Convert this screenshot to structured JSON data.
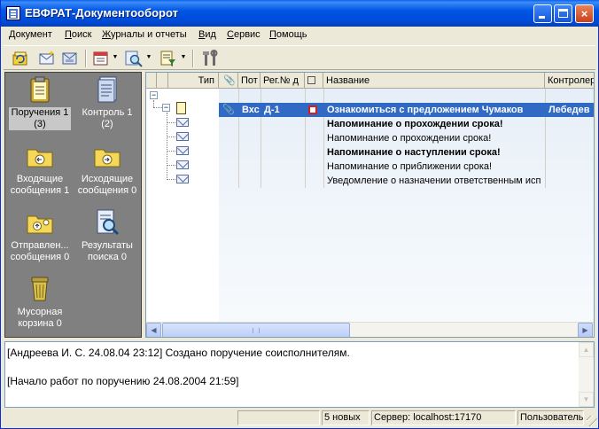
{
  "window": {
    "title": "ЕВФРАТ-Документооборот",
    "controls": {
      "minimize": "minimize",
      "maximize": "maximize",
      "close": "×"
    }
  },
  "menu": [
    {
      "label": "Документ",
      "u": "Д",
      "rest": "окумент"
    },
    {
      "label": "Поиск",
      "u": "П",
      "rest": "оиск"
    },
    {
      "label": "Журналы и отчеты",
      "u": "Ж",
      "rest": "урналы и отчеты"
    },
    {
      "label": "Вид",
      "u": "В",
      "rest": "ид"
    },
    {
      "label": "Сервис",
      "u": "С",
      "rest": "ервис"
    },
    {
      "label": "Помощь",
      "u": "П",
      "rest": "омощь"
    }
  ],
  "toolbar": {
    "icons": [
      "refresh-icon",
      "new-mail-icon",
      "mail-settings-icon",
      "calendar-icon",
      "search-icon",
      "filter-icon",
      "tools-icon"
    ]
  },
  "folders": [
    {
      "name": "poruchenia",
      "line1": "Поручения 1",
      "line2": "(3)",
      "selected": true
    },
    {
      "name": "control",
      "line1": "Контроль 1",
      "line2": "(2)",
      "selected": false
    },
    {
      "name": "incoming",
      "line1": "Входящие",
      "line2": "сообщения 1",
      "selected": false
    },
    {
      "name": "outgoing",
      "line1": "Исходящие",
      "line2": "сообщения 0",
      "selected": false
    },
    {
      "name": "sent",
      "line1": "Отправлен...",
      "line2": "сообщения 0",
      "selected": false
    },
    {
      "name": "search-results",
      "line1": "Результаты",
      "line2": "поиска 0",
      "selected": false
    },
    {
      "name": "trash",
      "line1": "Мусорная",
      "line2": "корзина 0",
      "selected": false
    }
  ],
  "grid": {
    "columns": {
      "type": "Тип",
      "attach": "",
      "sender": "Пот",
      "regnum": "Рег.№ д",
      "flag": "",
      "name": "Название",
      "controller": "Контролер"
    },
    "rows": [
      {
        "sender": "Вхс",
        "regnum": "Д-1",
        "name": "Ознакомиться с предложением Чумаков",
        "controller": "Лебедев",
        "selected": true,
        "bold": true
      },
      {
        "sender": "",
        "regnum": "",
        "name": "Напоминание о прохождении срока!",
        "controller": "",
        "selected": false,
        "bold": true
      },
      {
        "sender": "",
        "regnum": "",
        "name": "Напоминание о прохождении срока!",
        "controller": "",
        "selected": false,
        "bold": false
      },
      {
        "sender": "",
        "regnum": "",
        "name": "Напоминание о наступлении срока!",
        "controller": "",
        "selected": false,
        "bold": true
      },
      {
        "sender": "",
        "regnum": "",
        "name": "Напоминание о приближении срока!",
        "controller": "",
        "selected": false,
        "bold": false
      },
      {
        "sender": "",
        "regnum": "",
        "name": "Уведомление о назначении ответственным исп",
        "controller": "",
        "selected": false,
        "bold": false
      }
    ]
  },
  "log": [
    "[Андреева И. С. 24.08.04 23:12] Создано поручение соисполнителям.",
    "[Начало работ по поручению 24.08.2004 21:59]"
  ],
  "status": {
    "pane1": "",
    "pane2": "5 новых",
    "pane3": "Сервер: localhost:17170",
    "pane4": "Пользователь"
  },
  "colors": {
    "titlebar": "#0055e5",
    "selection": "#316ac5",
    "left_panel": "#808080"
  }
}
